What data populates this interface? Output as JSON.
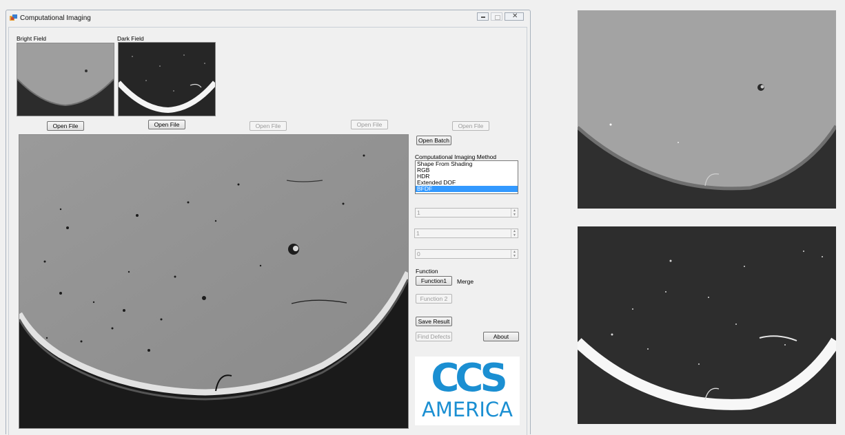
{
  "window": {
    "title": "Computational Imaging"
  },
  "thumbnails": {
    "bright_label": "Bright Field",
    "dark_label": "Dark Field"
  },
  "open_buttons": [
    "Open File",
    "Open File",
    "Open File",
    "Open File",
    "Open File"
  ],
  "open_batch": "Open Batch",
  "method": {
    "label": "Computational Imaging Method",
    "items": [
      "Shape From Shading",
      "RGB",
      "HDR",
      "Extended DOF",
      "BFDF"
    ],
    "selected": "BFDF"
  },
  "spinners": [
    "1",
    "1",
    "0"
  ],
  "function": {
    "label": "Function",
    "function1": "Function1",
    "merge_label": "Merge",
    "function2": "Function 2"
  },
  "save_result": "Save Result",
  "find_defects": "Find Defects",
  "about": "About",
  "logo": {
    "text_top": "CCS",
    "text_bottom": "AMERICA",
    "color": "#1b8fd2"
  },
  "colors": {
    "selection": "#3399ff",
    "bright_field_bg": "#9c9c9c",
    "dark_field_bg": "#2a2a2a"
  }
}
